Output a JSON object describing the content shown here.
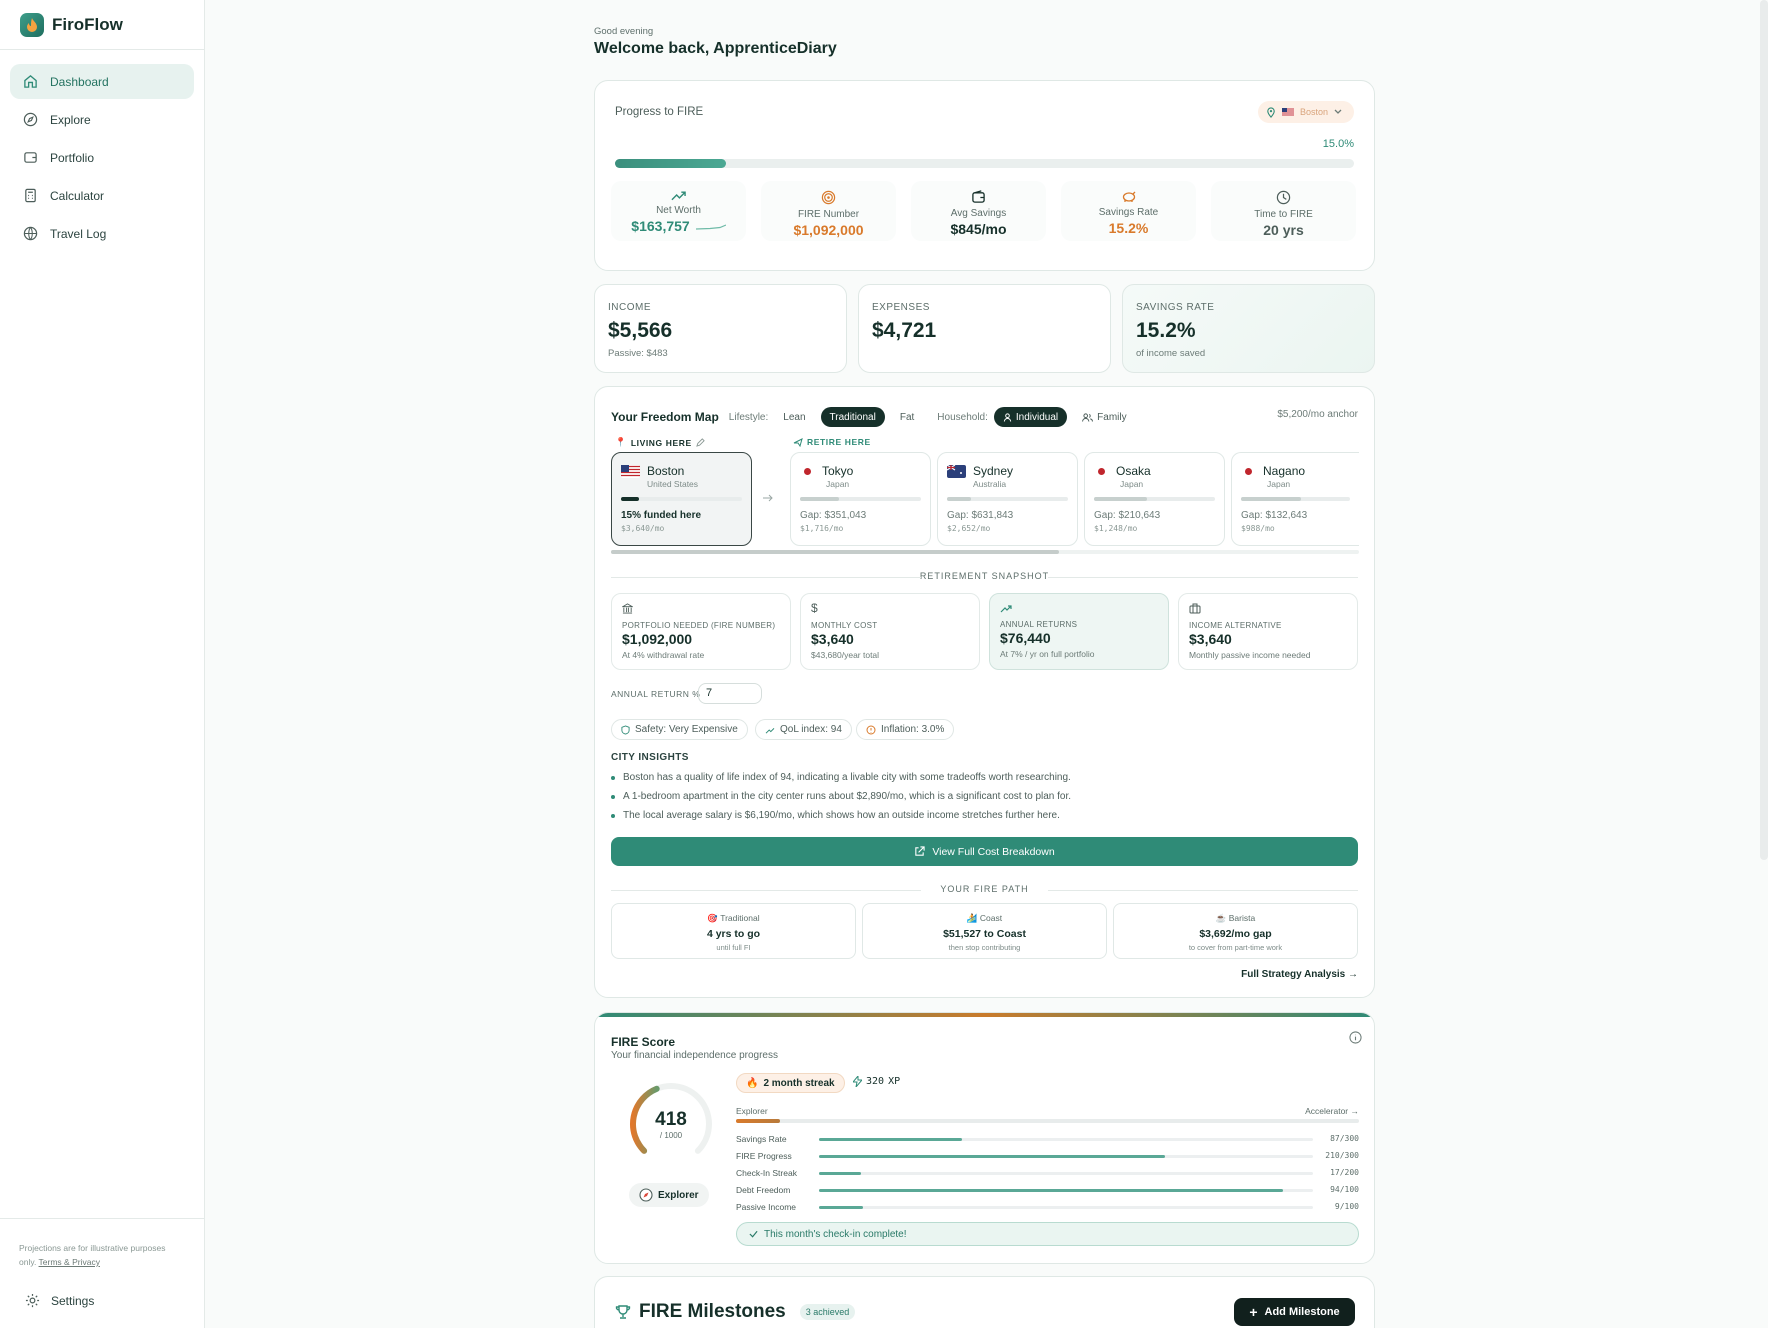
{
  "app": {
    "name": "FiroFlow"
  },
  "sidebar": {
    "items": [
      {
        "label": "Dashboard",
        "icon": "home-icon"
      },
      {
        "label": "Explore",
        "icon": "compass-icon"
      },
      {
        "label": "Portfolio",
        "icon": "wallet-icon"
      },
      {
        "label": "Calculator",
        "icon": "calculator-icon"
      },
      {
        "label": "Travel Log",
        "icon": "globe-icon"
      }
    ],
    "disclaimer": "Projections are for illustrative purposes only.",
    "terms_link": "Terms & Privacy",
    "settings_label": "Settings"
  },
  "header": {
    "greeting": "Good evening",
    "welcome": "Welcome back, ApprenticeDiary"
  },
  "progress": {
    "label": "Progress to FIRE",
    "country_select": "Boston",
    "percent_text": "15.0%",
    "percent": 15.0,
    "stats": [
      {
        "label": "Net Worth",
        "value": "$163,757",
        "icon": "trend-up-icon"
      },
      {
        "label": "FIRE Number",
        "value": "$1,092,000",
        "icon": "target-icon"
      },
      {
        "label": "Avg Savings",
        "value": "$845/mo",
        "icon": "wallet-icon"
      },
      {
        "label": "Savings Rate",
        "value": "15.2%",
        "icon": "piggy-bank-icon"
      },
      {
        "label": "Time to FIRE",
        "value": "20 yrs",
        "icon": "clock-icon"
      }
    ]
  },
  "summary": {
    "income": {
      "label": "INCOME",
      "value": "$5,566",
      "sub": "Passive: $483"
    },
    "expenses": {
      "label": "EXPENSES",
      "value": "$4,721"
    },
    "savings": {
      "label": "SAVINGS RATE",
      "value": "15.2%",
      "sub": "of income saved"
    }
  },
  "freedom_map": {
    "title": "Your Freedom Map",
    "lifestyle_label": "Lifestyle:",
    "lifestyle": [
      "Lean",
      "Traditional",
      "Fat"
    ],
    "household_label": "Household:",
    "household": [
      "Individual",
      "Family"
    ],
    "anchor": "$5,200/mo anchor",
    "living_here": "LIVING HERE",
    "retire_here": "RETIRE HERE",
    "home": {
      "city": "Boston",
      "country": "United States",
      "funded": "15% funded here",
      "monthly": "$3,640/mo",
      "funded_pct": 15
    },
    "cities": [
      {
        "city": "Tokyo",
        "country": "Japan",
        "gap": "Gap: $351,043",
        "monthly": "$1,716/mo",
        "funded_pct": 32
      },
      {
        "city": "Sydney",
        "country": "Australia",
        "gap": "Gap: $631,843",
        "monthly": "$2,652/mo",
        "funded_pct": 20
      },
      {
        "city": "Osaka",
        "country": "Japan",
        "gap": "Gap: $210,643",
        "monthly": "$1,248/mo",
        "funded_pct": 44
      },
      {
        "city": "Nagano",
        "country": "Japan",
        "gap": "Gap: $132,643",
        "monthly": "$988/mo",
        "funded_pct": 55
      }
    ],
    "snapshot_title": "RETIREMENT SNAPSHOT",
    "snapshot": [
      {
        "label": "PORTFOLIO NEEDED (FIRE NUMBER)",
        "value": "$1,092,000",
        "sub": "At 4% withdrawal rate",
        "icon": "bank-icon"
      },
      {
        "label": "MONTHLY COST",
        "value": "$3,640",
        "sub": "$43,680/year total",
        "icon": "dollar-icon"
      },
      {
        "label": "ANNUAL RETURNS",
        "value": "$76,440",
        "sub": "At 7% / yr on full portfolio",
        "icon": "trend-up-icon"
      },
      {
        "label": "INCOME ALTERNATIVE",
        "value": "$3,640",
        "sub": "Monthly passive income needed",
        "icon": "briefcase-icon"
      }
    ],
    "annual_return_label": "ANNUAL RETURN %",
    "annual_return_value": "7",
    "chips": [
      "Safety: Very Expensive",
      "QoL index: 94",
      "Inflation: 3.0%"
    ],
    "insights_title": "CITY INSIGHTS",
    "insights": [
      "Boston has a quality of life index of 94, indicating a livable city with some tradeoffs worth researching.",
      "A 1-bedroom apartment in the city center runs about $2,890/mo, which is a significant cost to plan for.",
      "The local average salary is $6,190/mo, which shows how an outside income stretches further here."
    ],
    "cta": "View Full Cost Breakdown",
    "path_title": "YOUR FIRE PATH",
    "paths": [
      {
        "title": "Traditional",
        "value": "4 yrs to go",
        "sub": "until full FI"
      },
      {
        "title": "Coast",
        "value": "$51,527 to Coast",
        "sub": "then stop contributing"
      },
      {
        "title": "Barista",
        "value": "$3,692/mo gap",
        "sub": "to cover from part-time work"
      }
    ],
    "strategy_link": "Full Strategy Analysis →"
  },
  "fire_score": {
    "title": "FIRE Score",
    "subtitle": "Your financial independence progress",
    "score": "418",
    "max": "/ 1000",
    "score_fraction": 0.418,
    "level": "Explorer",
    "streak": "2 month streak",
    "xp": "320",
    "xp_label": "XP",
    "level_from": "Explorer",
    "level_to": "Accelerator →",
    "level_progress": 0.07,
    "metrics": [
      {
        "label": "Savings Rate",
        "value": "87/300",
        "fraction": 0.29
      },
      {
        "label": "FIRE Progress",
        "value": "210/300",
        "fraction": 0.7
      },
      {
        "label": "Check-In Streak",
        "value": "17/200",
        "fraction": 0.085
      },
      {
        "label": "Debt Freedom",
        "value": "94/100",
        "fraction": 0.94
      },
      {
        "label": "Passive Income",
        "value": "9/100",
        "fraction": 0.09
      }
    ],
    "checkin": "This month's check-in complete!"
  },
  "milestones": {
    "title": "FIRE Milestones",
    "badge": "3 achieved",
    "add_button": "Add Milestone"
  }
}
